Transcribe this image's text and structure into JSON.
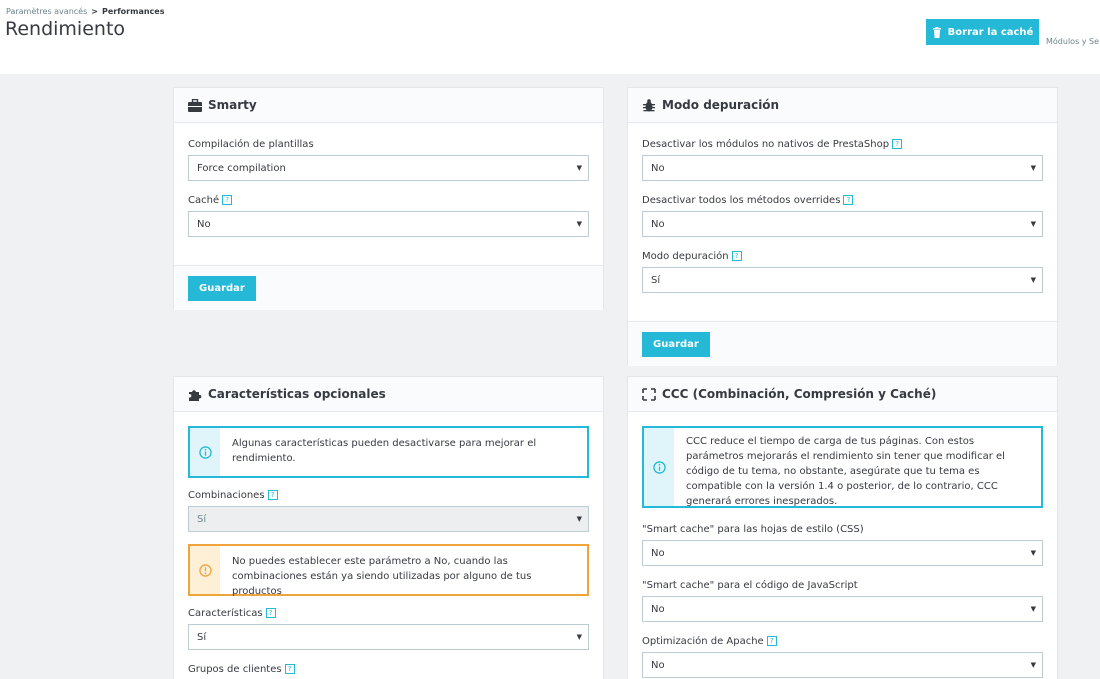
{
  "header": {
    "breadcrumb_parent": "Paramètres avancés",
    "breadcrumb_sep": ">",
    "breadcrumb_current": "Performances",
    "title": "Rendimiento",
    "clear_cache_label": "Borrar la caché",
    "modules_link": "Módulos y Se"
  },
  "smarty": {
    "title": "Smarty",
    "icon": "briefcase-icon",
    "compile_label": "Compilación de plantillas",
    "compile_value": "Force compilation",
    "cache_label": "Caché",
    "cache_value": "No",
    "save_label": "Guardar"
  },
  "debug": {
    "title": "Modo depuración",
    "icon": "bug-icon",
    "nonnative_label": "Desactivar los módulos no nativos de PrestaShop",
    "nonnative_value": "No",
    "overrides_label": "Desactivar todos los métodos overrides",
    "overrides_value": "No",
    "debug_label": "Modo depuración",
    "debug_value": "Sí",
    "save_label": "Guardar"
  },
  "optional": {
    "title": "Características opcionales",
    "icon": "puzzle-icon",
    "info_text": "Algunas características pueden desactivarse para mejorar el rendimiento.",
    "combinations_label": "Combinaciones",
    "combinations_value": "Sí",
    "warning_text": "No puedes establecer este parámetro a No, cuando las combinaciones están ya siendo utilizadas por alguno de tus productos",
    "features_label": "Características",
    "features_value": "Sí",
    "groups_label": "Grupos de clientes"
  },
  "ccc": {
    "title": "CCC (Combinación, Compresión y Caché)",
    "icon": "fullscreen-icon",
    "info_text": "CCC reduce el tiempo de carga de tus páginas. Con estos parámetros mejorarás el rendimiento sin tener que modificar el código de tu tema, no obstante, asegúrate que tu tema es compatible con la versión 1.4 o posterior, de lo contrario, CCC generará errores inesperados.",
    "css_label": "\"Smart cache\" para las hojas de estilo (CSS)",
    "css_value": "No",
    "js_label": "\"Smart cache\" para el código de JavaScript",
    "js_value": "No",
    "apache_label": "Optimización de Apache",
    "apache_value": "No"
  },
  "colors": {
    "accent": "#25b9d7",
    "warning": "#f0a43c"
  },
  "help_glyph": "?"
}
